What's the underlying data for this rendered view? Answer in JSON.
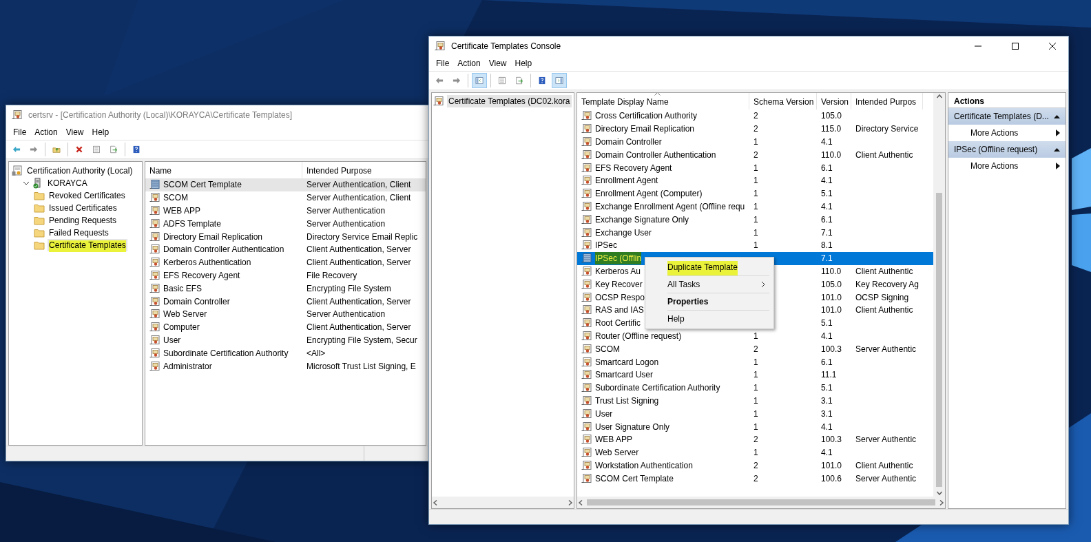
{
  "certsrv_window": {
    "title": "certsrv - [Certification Authority (Local)\\KORAYCA\\Certificate Templates]",
    "menu": [
      "File",
      "Action",
      "View",
      "Help"
    ],
    "toolbar": [
      {
        "kind": "back",
        "disabled": false
      },
      {
        "kind": "forward",
        "disabled": true
      },
      {
        "kind": "separator"
      },
      {
        "kind": "up",
        "disabled": false
      },
      {
        "kind": "separator"
      },
      {
        "kind": "delete",
        "disabled": false
      },
      {
        "kind": "properties",
        "disabled": false
      },
      {
        "kind": "export",
        "disabled": false
      },
      {
        "kind": "separator"
      },
      {
        "kind": "help",
        "disabled": false
      }
    ],
    "tree": [
      {
        "label": "Certification Authority (Local)",
        "kind": "ca",
        "selected": false,
        "highlighted": false,
        "children": [
          {
            "label": "KORAYCA",
            "kind": "server",
            "expanded": true,
            "selected": false,
            "highlighted": false,
            "children": [
              {
                "label": "Revoked Certificates",
                "kind": "folder",
                "selected": false,
                "highlighted": false
              },
              {
                "label": "Issued Certificates",
                "kind": "folder",
                "selected": false,
                "highlighted": false
              },
              {
                "label": "Pending Requests",
                "kind": "folder",
                "selected": false,
                "highlighted": false
              },
              {
                "label": "Failed Requests",
                "kind": "folder",
                "selected": false,
                "highlighted": false
              },
              {
                "label": "Certificate Templates",
                "kind": "folder",
                "selected": true,
                "highlighted": true
              }
            ]
          }
        ]
      }
    ],
    "columns": [
      "Name",
      "Intended Purpose"
    ],
    "rows": [
      {
        "name": "SCOM Cert Template",
        "purpose": "Server Authentication, Client",
        "selected": true
      },
      {
        "name": "SCOM",
        "purpose": "Server Authentication, Client",
        "selected": false
      },
      {
        "name": "WEB APP",
        "purpose": "Server Authentication",
        "selected": false
      },
      {
        "name": "ADFS Template",
        "purpose": "Server Authentication",
        "selected": false
      },
      {
        "name": "Directory Email Replication",
        "purpose": "Directory Service Email Replic",
        "selected": false
      },
      {
        "name": "Domain Controller Authentication",
        "purpose": "Client Authentication, Server",
        "selected": false
      },
      {
        "name": "Kerberos Authentication",
        "purpose": "Client Authentication, Server",
        "selected": false
      },
      {
        "name": "EFS Recovery Agent",
        "purpose": "File Recovery",
        "selected": false
      },
      {
        "name": "Basic EFS",
        "purpose": "Encrypting File System",
        "selected": false
      },
      {
        "name": "Domain Controller",
        "purpose": "Client Authentication, Server",
        "selected": false
      },
      {
        "name": "Web Server",
        "purpose": "Server Authentication",
        "selected": false
      },
      {
        "name": "Computer",
        "purpose": "Client Authentication, Server",
        "selected": false
      },
      {
        "name": "User",
        "purpose": "Encrypting File System, Secur",
        "selected": false
      },
      {
        "name": "Subordinate Certification Authority",
        "purpose": "<All>",
        "selected": false
      },
      {
        "name": "Administrator",
        "purpose": "Microsoft Trust List Signing, E",
        "selected": false
      }
    ]
  },
  "console_window": {
    "title": "Certificate Templates Console",
    "menu": [
      "File",
      "Action",
      "View",
      "Help"
    ],
    "toolbar": [
      {
        "kind": "back",
        "disabled": true,
        "pressed": false
      },
      {
        "kind": "forward",
        "disabled": true,
        "pressed": false
      },
      {
        "kind": "separator"
      },
      {
        "kind": "tree-toggle",
        "disabled": false,
        "pressed": true
      },
      {
        "kind": "separator"
      },
      {
        "kind": "properties",
        "disabled": false,
        "pressed": false
      },
      {
        "kind": "export",
        "disabled": false,
        "pressed": false
      },
      {
        "kind": "separator"
      },
      {
        "kind": "help",
        "disabled": false,
        "pressed": false
      },
      {
        "kind": "action-pane",
        "disabled": false,
        "pressed": true
      }
    ],
    "tree": [
      {
        "label": "Certificate Templates (DC02.kora",
        "selected": true
      }
    ],
    "columns": [
      "Template Display Name",
      "Schema Version",
      "Version",
      "Intended Purpos"
    ],
    "rows": [
      {
        "name": "Cross Certification Authority",
        "schema": "2",
        "version": "105.0",
        "selected": false,
        "highlighted": false
      },
      {
        "name": "Directory Email Replication",
        "schema": "2",
        "version": "115.0",
        "purpose": "Directory Service",
        "selected": false,
        "highlighted": false
      },
      {
        "name": "Domain Controller",
        "schema": "1",
        "version": "4.1",
        "selected": false,
        "highlighted": false
      },
      {
        "name": "Domain Controller Authentication",
        "schema": "2",
        "version": "110.0",
        "purpose": "Client Authentic",
        "selected": false,
        "highlighted": false
      },
      {
        "name": "EFS Recovery Agent",
        "schema": "1",
        "version": "6.1",
        "selected": false,
        "highlighted": false
      },
      {
        "name": "Enrollment Agent",
        "schema": "1",
        "version": "4.1",
        "selected": false,
        "highlighted": false
      },
      {
        "name": "Enrollment Agent (Computer)",
        "schema": "1",
        "version": "5.1",
        "selected": false,
        "highlighted": false
      },
      {
        "name": "Exchange Enrollment Agent (Offline requ",
        "schema": "1",
        "version": "4.1",
        "selected": false,
        "highlighted": false
      },
      {
        "name": "Exchange Signature Only",
        "schema": "1",
        "version": "6.1",
        "selected": false,
        "highlighted": false
      },
      {
        "name": "Exchange User",
        "schema": "1",
        "version": "7.1",
        "selected": false,
        "highlighted": false
      },
      {
        "name": "IPSec",
        "schema": "1",
        "version": "8.1",
        "selected": false,
        "highlighted": false
      },
      {
        "name": "IPSec (Offlin",
        "version": "7.1",
        "selected": true,
        "highlighted": true
      },
      {
        "name": "Kerberos Au",
        "version": "110.0",
        "purpose": "Client Authentic",
        "selected": false,
        "highlighted": false
      },
      {
        "name": "Key Recover",
        "version": "105.0",
        "purpose": "Key Recovery Ag",
        "selected": false,
        "highlighted": false
      },
      {
        "name": "OCSP Respo",
        "version": "101.0",
        "purpose": "OCSP Signing",
        "selected": false,
        "highlighted": false
      },
      {
        "name": "RAS and IAS",
        "version": "101.0",
        "purpose": "Client Authentic",
        "selected": false,
        "highlighted": false
      },
      {
        "name": "Root Certific",
        "version": "5.1",
        "selected": false,
        "highlighted": false
      },
      {
        "name": "Router (Offline request)",
        "schema": "1",
        "version": "4.1",
        "selected": false,
        "highlighted": false
      },
      {
        "name": "SCOM",
        "schema": "2",
        "version": "100.3",
        "purpose": "Server Authentic",
        "selected": false,
        "highlighted": false
      },
      {
        "name": "Smartcard Logon",
        "schema": "1",
        "version": "6.1",
        "selected": false,
        "highlighted": false
      },
      {
        "name": "Smartcard User",
        "schema": "1",
        "version": "11.1",
        "selected": false,
        "highlighted": false
      },
      {
        "name": "Subordinate Certification Authority",
        "schema": "1",
        "version": "5.1",
        "selected": false,
        "highlighted": false
      },
      {
        "name": "Trust List Signing",
        "schema": "1",
        "version": "3.1",
        "selected": false,
        "highlighted": false
      },
      {
        "name": "User",
        "schema": "1",
        "version": "3.1",
        "selected": false,
        "highlighted": false
      },
      {
        "name": "User Signature Only",
        "schema": "1",
        "version": "4.1",
        "selected": false,
        "highlighted": false
      },
      {
        "name": "WEB APP",
        "schema": "2",
        "version": "100.3",
        "purpose": "Server Authentic",
        "selected": false,
        "highlighted": false
      },
      {
        "name": "Web Server",
        "schema": "1",
        "version": "4.1",
        "selected": false,
        "highlighted": false
      },
      {
        "name": "Workstation Authentication",
        "schema": "2",
        "version": "101.0",
        "purpose": "Client Authentic",
        "selected": false,
        "highlighted": false
      },
      {
        "name": "SCOM Cert Template",
        "schema": "2",
        "version": "100.6",
        "purpose": "Server Authentic",
        "selected": false,
        "highlighted": false
      }
    ],
    "context_menu": [
      {
        "label": "Duplicate Template",
        "kind": "item",
        "default": false,
        "highlighted": true
      },
      {
        "label": "All Tasks",
        "kind": "submenu",
        "default": false,
        "highlighted": false
      },
      {
        "label": "Properties",
        "kind": "item",
        "default": true,
        "highlighted": false
      },
      {
        "label": "Help",
        "kind": "item",
        "default": false,
        "highlighted": false
      }
    ],
    "actions": {
      "title": "Actions",
      "groups": [
        {
          "title": "Certificate Templates (D...",
          "items": [
            "More Actions"
          ]
        },
        {
          "title": "IPSec (Offline request)",
          "items": [
            "More Actions"
          ]
        }
      ]
    }
  }
}
